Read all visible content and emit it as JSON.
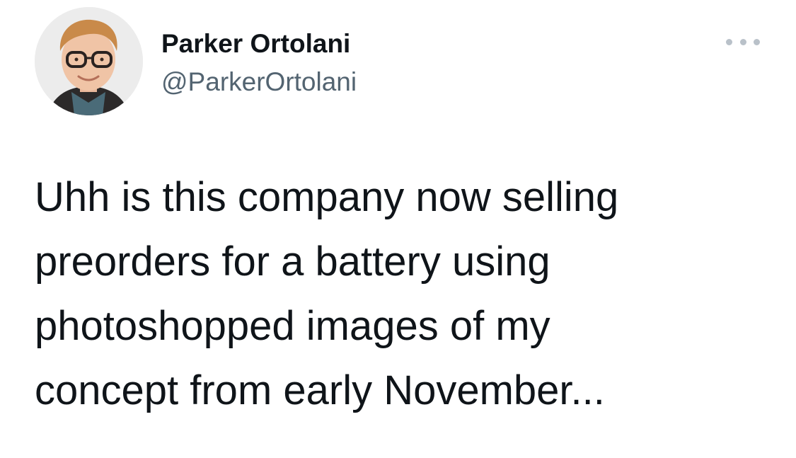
{
  "author": {
    "name": "Parker Ortolani",
    "handle": "@ParkerOrtolani",
    "avatar_icon": "profile-photo"
  },
  "more_menu": {
    "icon": "more-horizontal-icon"
  },
  "tweet": {
    "text": "Uhh is this company now selling\npreorders for a battery using\nphotoshopped images of my\nconcept from early November..."
  },
  "colors": {
    "text_primary": "#0f1419",
    "text_secondary": "#536471",
    "more_icon": "#b9c1c9",
    "background": "#ffffff"
  }
}
